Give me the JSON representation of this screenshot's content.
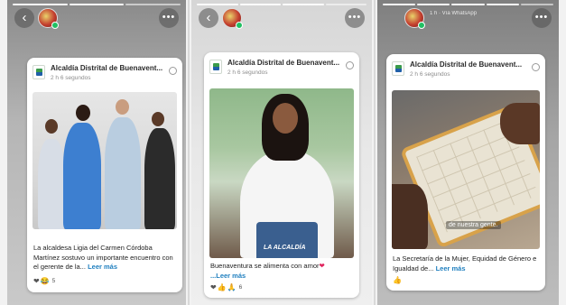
{
  "stories": [
    {
      "channel_name": "Alcaldía Distrital de Buenavent...",
      "time": "2 h 6 segundos",
      "caption": "La alcaldesa Ligia del Carmen Córdoba Martínez sostuvo un importante encuentro con el gerente de la...",
      "more_label": "Leer más",
      "reactions": [
        "❤",
        "😂"
      ],
      "reaction_count": "5"
    },
    {
      "channel_name": "Alcaldía Distrital de Buenavent...",
      "time": "2 h 6 segundos",
      "caption": "Buenaventura se alimenta con amor",
      "caption_emoji": "❤",
      "more_label": "...Leer más",
      "overlay_text": "LA ALCALDÍA",
      "reactions": [
        "❤",
        "👍",
        "🙏"
      ],
      "reaction_count": "6"
    },
    {
      "channel_name": "Alcaldía Distrital de Buenavent...",
      "time": "2 h 6 segundos",
      "caption": "La Secretaría de la Mujer, Equidad de Género e Igualdad de...",
      "more_label": "Leer más",
      "overlay_text": "de nuestra gente.",
      "reactions": [
        "👍"
      ],
      "reaction_count": ""
    }
  ],
  "top_mini_labels": {
    "story3_header": "1 h · Vía WhatsApp"
  },
  "icons": {
    "back": "back-arrow-icon",
    "more": "more-options-icon",
    "menu": "card-menu-icon"
  },
  "colors": {
    "link": "#1f7fbf",
    "online": "#21c063"
  }
}
